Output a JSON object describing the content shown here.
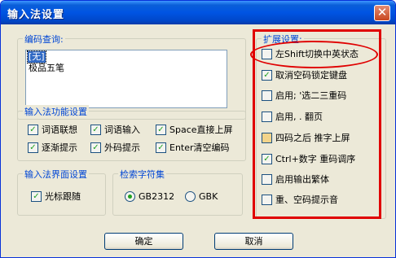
{
  "window": {
    "title": "输入法设置",
    "close_symbol": "✕"
  },
  "code_query": {
    "legend": "编码查询:",
    "items": [
      "[无]",
      "极品五笔"
    ],
    "selected": 0
  },
  "functions": {
    "legend": "输入法功能设置",
    "options": [
      {
        "label": "词语联想",
        "checked": true
      },
      {
        "label": "词语输入",
        "checked": true
      },
      {
        "label": "Space直接上屏",
        "checked": true
      },
      {
        "label": "逐渐提示",
        "checked": true
      },
      {
        "label": "外码提示",
        "checked": true
      },
      {
        "label": "Enter清空编码",
        "checked": true
      }
    ]
  },
  "interface": {
    "legend": "输入法界面设置",
    "options": [
      {
        "label": "光标跟随",
        "checked": true
      }
    ]
  },
  "charset": {
    "legend": "检索字符集",
    "options": [
      {
        "label": "GB2312",
        "selected": true
      },
      {
        "label": "GBK",
        "selected": false
      }
    ]
  },
  "extension": {
    "legend": "扩展设置:",
    "options": [
      {
        "label": "左Shift切换中英状态",
        "checked": false
      },
      {
        "label": "取消空码锁定键盘",
        "checked": true
      },
      {
        "label": "启用; '选二三重码",
        "checked": false
      },
      {
        "label": "启用, . 翻页",
        "checked": false
      },
      {
        "label": "四码之后 推字上屏",
        "checked": false,
        "indeterminate": true
      },
      {
        "label": "Ctrl+数字 重码调序",
        "checked": true
      },
      {
        "label": "启用输出繁体",
        "checked": false
      },
      {
        "label": "重、空码提示音",
        "checked": false
      }
    ]
  },
  "buttons": {
    "ok": "确定",
    "cancel": "取消"
  },
  "colors": {
    "titlebar": "#0054e3",
    "legend_text": "#0046d5",
    "highlight": "#e00000",
    "check": "#21a121"
  }
}
